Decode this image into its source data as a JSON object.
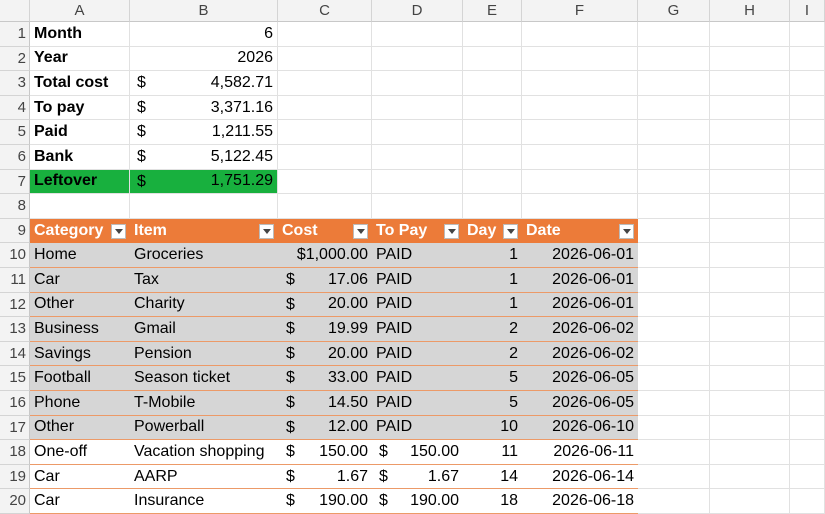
{
  "columns": [
    "A",
    "B",
    "C",
    "D",
    "E",
    "F",
    "G",
    "H",
    "I"
  ],
  "row_numbers": [
    "1",
    "2",
    "3",
    "4",
    "5",
    "6",
    "7",
    "8",
    "9",
    "10",
    "11",
    "12",
    "13",
    "14",
    "15",
    "16",
    "17",
    "18",
    "19",
    "20"
  ],
  "summary": [
    {
      "label": "Month",
      "currency": "",
      "value": "6"
    },
    {
      "label": "Year",
      "currency": "",
      "value": "2026"
    },
    {
      "label": "Total cost",
      "currency": "$",
      "value": "4,582.71"
    },
    {
      "label": "To pay",
      "currency": "$",
      "value": "3,371.16"
    },
    {
      "label": "Paid",
      "currency": "$",
      "value": "1,211.55"
    },
    {
      "label": "Bank",
      "currency": "$",
      "value": "5,122.45"
    },
    {
      "label": "Leftover",
      "currency": "$",
      "value": "1,751.29"
    }
  ],
  "table": {
    "headers": [
      "Category",
      "Item",
      "Cost",
      "To Pay",
      "Day",
      "Date"
    ],
    "rows": [
      {
        "category": "Home",
        "item": "Groceries",
        "cost_cur": "",
        "cost": "$1,000.00",
        "pay_cur": "",
        "pay": "PAID",
        "day": "1",
        "date": "2026-06-01"
      },
      {
        "category": "Car",
        "item": "Tax",
        "cost_cur": "$",
        "cost": "17.06",
        "pay_cur": "",
        "pay": "PAID",
        "day": "1",
        "date": "2026-06-01"
      },
      {
        "category": "Other",
        "item": "Charity",
        "cost_cur": "$",
        "cost": "20.00",
        "pay_cur": "",
        "pay": "PAID",
        "day": "1",
        "date": "2026-06-01"
      },
      {
        "category": "Business",
        "item": "Gmail",
        "cost_cur": "$",
        "cost": "19.99",
        "pay_cur": "",
        "pay": "PAID",
        "day": "2",
        "date": "2026-06-02"
      },
      {
        "category": "Savings",
        "item": "Pension",
        "cost_cur": "$",
        "cost": "20.00",
        "pay_cur": "",
        "pay": "PAID",
        "day": "2",
        "date": "2026-06-02"
      },
      {
        "category": "Football",
        "item": "Season ticket",
        "cost_cur": "$",
        "cost": "33.00",
        "pay_cur": "",
        "pay": "PAID",
        "day": "5",
        "date": "2026-06-05"
      },
      {
        "category": "Phone",
        "item": "T-Mobile",
        "cost_cur": "$",
        "cost": "14.50",
        "pay_cur": "",
        "pay": "PAID",
        "day": "5",
        "date": "2026-06-05"
      },
      {
        "category": "Other",
        "item": "Powerball",
        "cost_cur": "$",
        "cost": "12.00",
        "pay_cur": "",
        "pay": "PAID",
        "day": "10",
        "date": "2026-06-10"
      },
      {
        "category": "One-off",
        "item": "Vacation shopping",
        "cost_cur": "$",
        "cost": "150.00",
        "pay_cur": "$",
        "pay": "150.00",
        "day": "11",
        "date": "2026-06-11"
      },
      {
        "category": "Car",
        "item": "AARP",
        "cost_cur": "$",
        "cost": "1.67",
        "pay_cur": "$",
        "pay": "1.67",
        "day": "14",
        "date": "2026-06-14"
      },
      {
        "category": "Car",
        "item": "Insurance",
        "cost_cur": "$",
        "cost": "190.00",
        "pay_cur": "$",
        "pay": "190.00",
        "day": "18",
        "date": "2026-06-18"
      }
    ]
  },
  "colors": {
    "header_orange": "#ec7b39",
    "leftover_green": "#18b03e",
    "paid_row_gray": "#d6d6d6"
  }
}
